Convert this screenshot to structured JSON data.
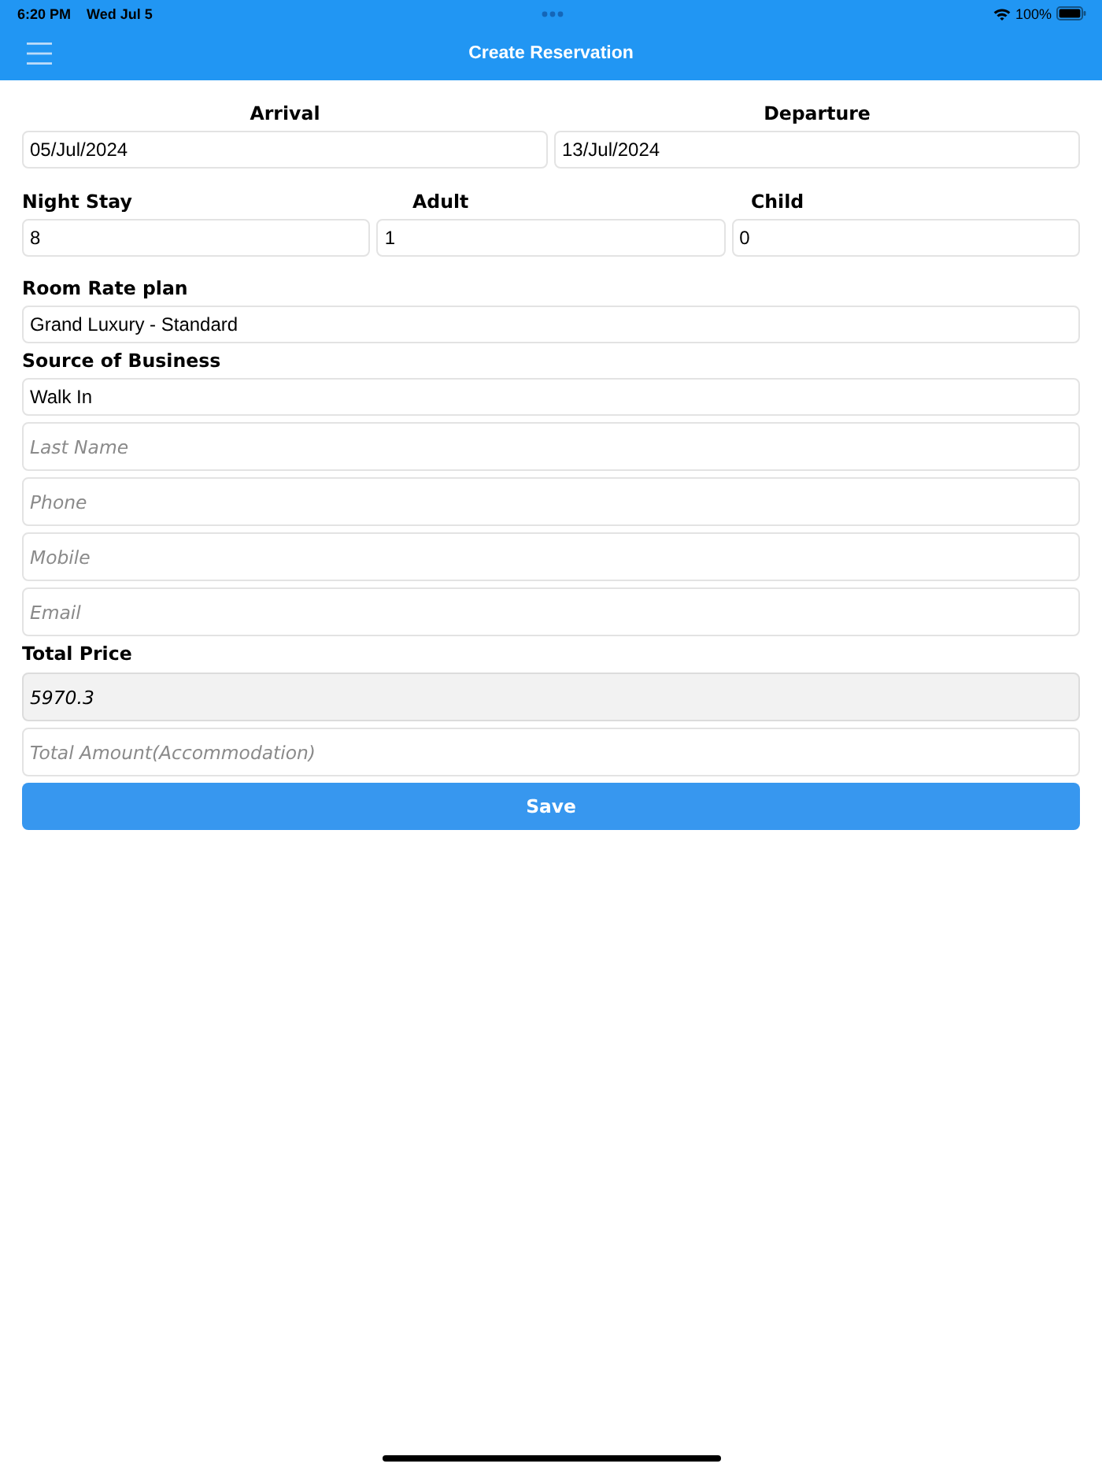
{
  "status_bar": {
    "time": "6:20 PM",
    "date": "Wed Jul 5",
    "battery": "100%"
  },
  "header": {
    "title": "Create Reservation"
  },
  "dates": [
    {
      "label": "Arrival",
      "value": "05/Jul/2024"
    },
    {
      "label": "Departure",
      "value": "13/Jul/2024"
    }
  ],
  "guests": [
    {
      "label": "Night Stay",
      "value": "8"
    },
    {
      "label": "Adult",
      "value": "1"
    },
    {
      "label": "Child",
      "value": "0"
    }
  ],
  "room_rate_plan": {
    "label": "Room Rate plan",
    "value": "Grand Luxury - Standard"
  },
  "source_of_business": {
    "label": "Source of Business",
    "value": "Walk In"
  },
  "contact_fields": [
    {
      "placeholder": "Last Name"
    },
    {
      "placeholder": "Phone"
    },
    {
      "placeholder": "Mobile"
    },
    {
      "placeholder": "Email"
    }
  ],
  "total_price": {
    "label": "Total Price",
    "value": "5970.3",
    "disabled": true
  },
  "total_amount": {
    "placeholder": "Total Amount(Accommodation)"
  },
  "save_button": {
    "label": "Save"
  }
}
